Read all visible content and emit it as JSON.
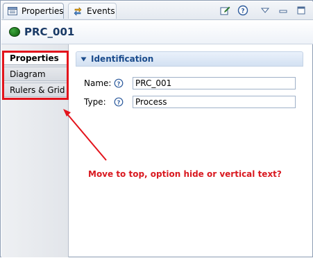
{
  "tabs": {
    "properties_label": "Properties",
    "events_label": "Events"
  },
  "toolbar": {
    "icons": [
      "edit-page-icon",
      "help-icon",
      "view-menu-icon",
      "minimize-icon",
      "maximize-icon"
    ]
  },
  "header": {
    "title": "PRC_001",
    "status_color": "#1e8a1e"
  },
  "sidebar": {
    "items": [
      {
        "label": "Properties",
        "selected": true
      },
      {
        "label": "Diagram",
        "selected": false
      },
      {
        "label": "Rulers & Grid",
        "selected": false
      }
    ]
  },
  "section": {
    "title": "Identification",
    "fields": [
      {
        "label": "Name:",
        "value": "PRC_001"
      },
      {
        "label": "Type:",
        "value": "Process"
      }
    ]
  },
  "annotation": {
    "text": "Move to top, option hide or vertical text?",
    "color": "#e3141c"
  }
}
